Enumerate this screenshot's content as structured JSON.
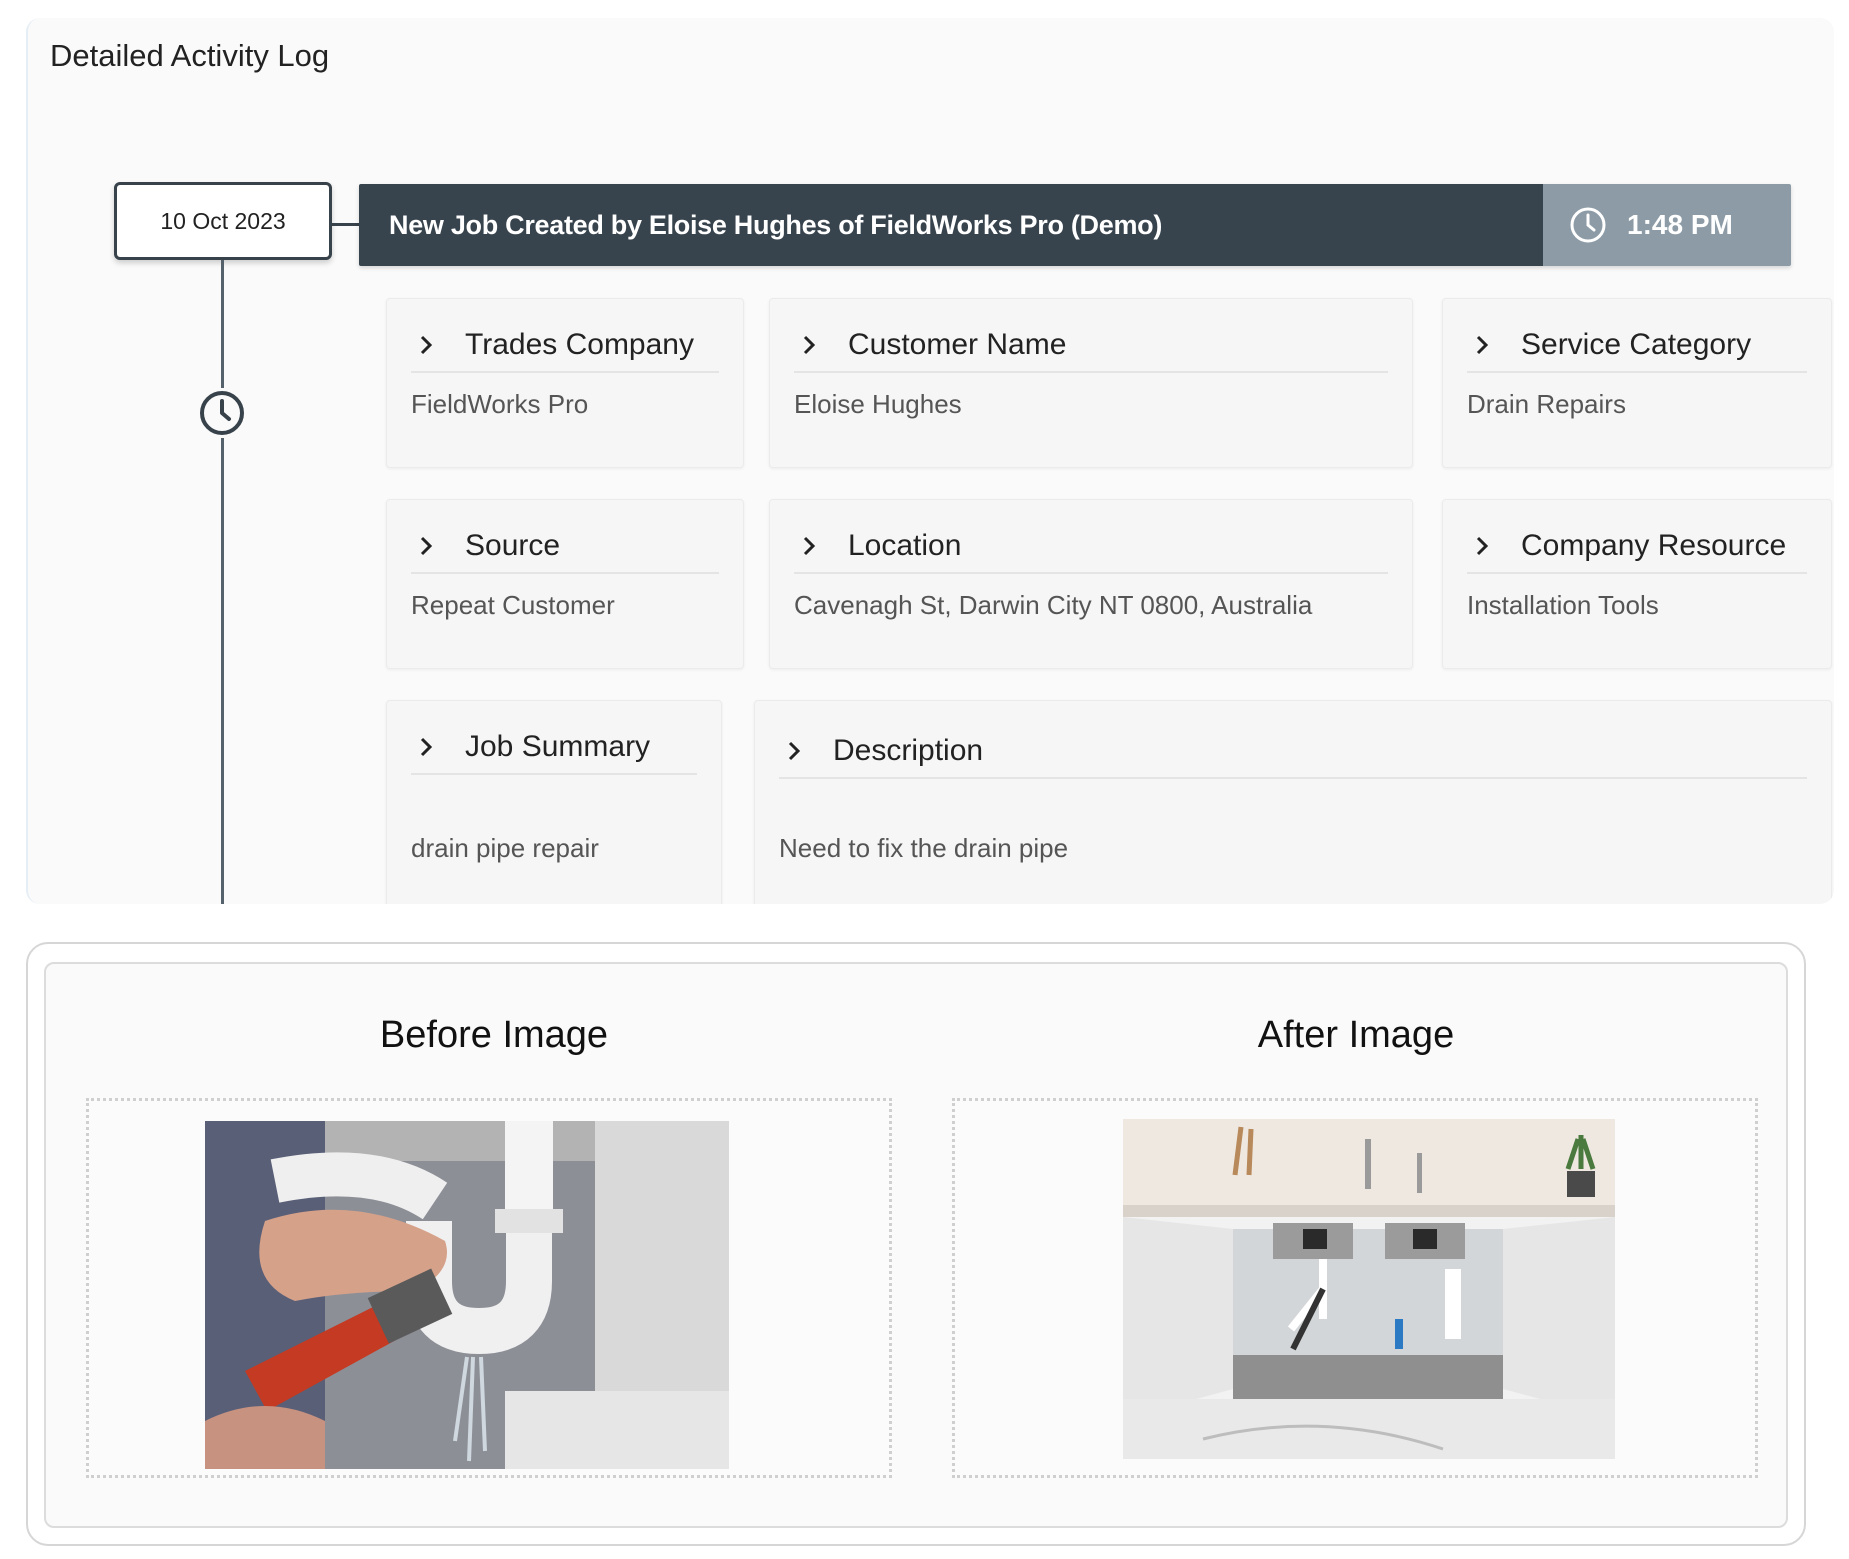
{
  "log": {
    "title": "Detailed Activity Log",
    "date": "10 Oct 2023",
    "event_title": "New Job Created by Eloise Hughes of FieldWorks Pro (Demo)",
    "event_time": "1:48 PM",
    "fields": [
      {
        "label": "Trades Company",
        "value": "FieldWorks Pro"
      },
      {
        "label": "Customer Name",
        "value": "Eloise Hughes"
      },
      {
        "label": "Service Category",
        "value": "Drain Repairs"
      },
      {
        "label": "Source",
        "value": "Repeat Customer"
      },
      {
        "label": "Location",
        "value": "Cavenagh St, Darwin City NT 0800, Australia"
      },
      {
        "label": "Company Resource",
        "value": "Installation Tools"
      },
      {
        "label": "Job Summary",
        "value": "drain pipe repair"
      },
      {
        "label": "Description",
        "value": "Need to fix the drain pipe"
      }
    ]
  },
  "images": {
    "before_title": "Before Image",
    "after_title": "After Image"
  },
  "colors": {
    "header_dark": "#37434d",
    "header_time": "#8c9ba6",
    "timeline": "#56626b"
  },
  "icons": [
    "clock-icon",
    "chevron-right-icon"
  ]
}
